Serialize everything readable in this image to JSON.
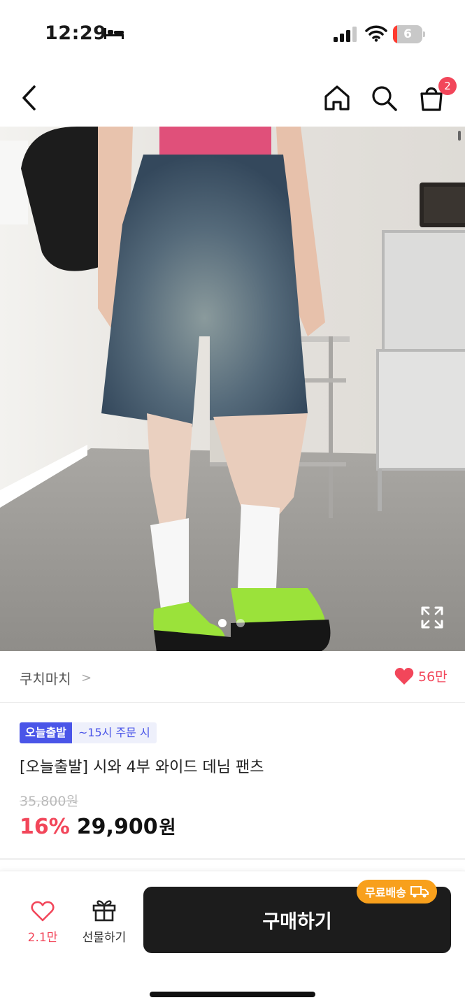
{
  "status": {
    "time": "12:29",
    "battery_level": "6",
    "icons": [
      "bed-icon",
      "signal-icon",
      "wifi-icon",
      "battery-icon"
    ]
  },
  "nav": {
    "icons": [
      "back-icon",
      "home-icon",
      "search-icon",
      "cart-icon"
    ],
    "cart_count": "2"
  },
  "gallery": {
    "page_count": 2,
    "current_page": 1,
    "icons": [
      "expand-icon"
    ]
  },
  "store": {
    "name": "쿠치마치",
    "chevron": ">",
    "likes": "56만"
  },
  "product": {
    "delivery_badge": "오늘출발",
    "delivery_time": "~15시 주문 시",
    "title": "[오늘출발] 시와 4부 와이드 데님 팬츠",
    "original_price": "35,800원",
    "discount": "16%",
    "price": "29,900",
    "currency": "원"
  },
  "bottom": {
    "wish_count": "2.1만",
    "gift_label": "선물하기",
    "buy_label": "구매하기",
    "free_shipping": "무료배송"
  },
  "colors": {
    "accent_red": "#f2465a",
    "delivery_blue": "#4a55e8",
    "free_ship_orange": "#f8a01c",
    "buy_button": "#1c1c1c"
  }
}
